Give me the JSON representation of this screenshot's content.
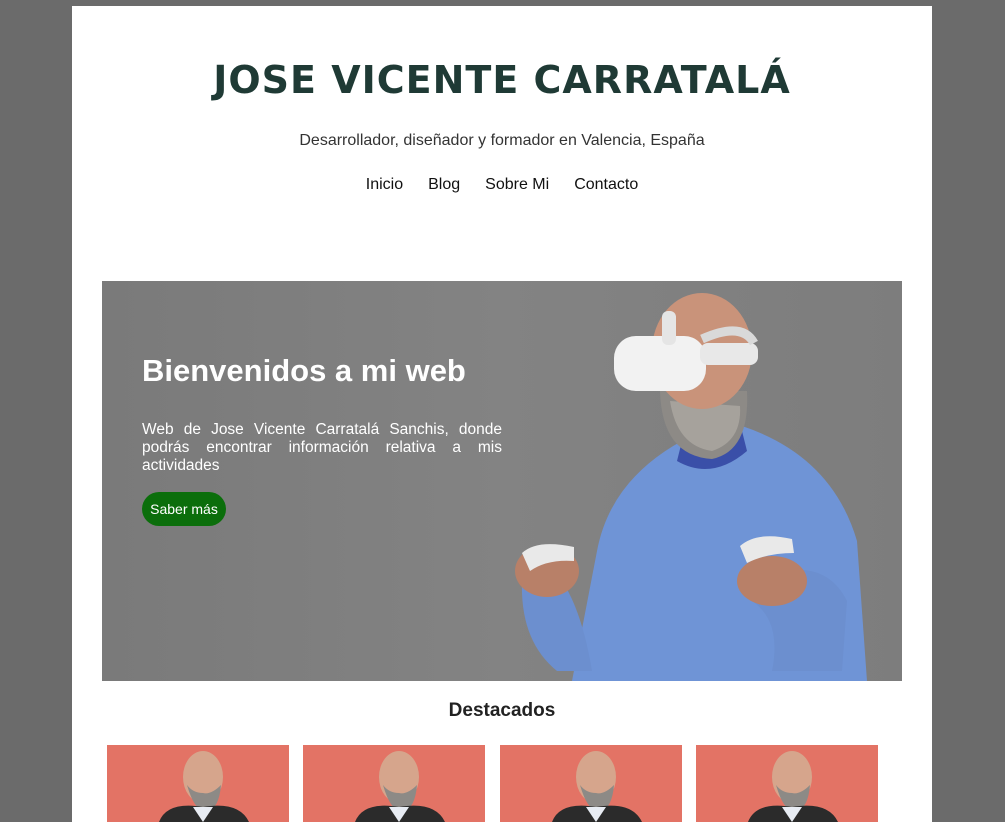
{
  "site": {
    "title": "JOSE VICENTE CARRATALÁ",
    "tagline": "Desarrollador, diseñador y formador en Valencia, España"
  },
  "nav": {
    "items": [
      "Inicio",
      "Blog",
      "Sobre Mi",
      "Contacto"
    ]
  },
  "hero": {
    "title": "Bienvenidos a mi web",
    "text": "Web de Jose Vicente Carratalá Sanchis, donde podrás encontrar información relativa a mis actividades",
    "button_label": "Saber más"
  },
  "featured": {
    "heading": "Destacados",
    "card_count": 4
  },
  "colors": {
    "background": "#6b6b6b",
    "title": "#1f3a35",
    "button": "#0b6e0b",
    "card_background": "#e0685a"
  }
}
